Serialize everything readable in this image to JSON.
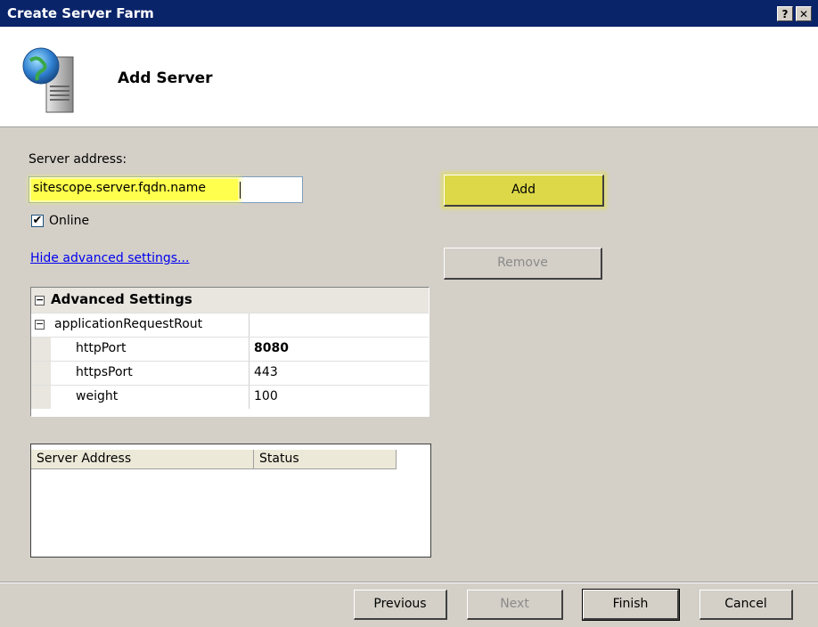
{
  "window": {
    "title": "Create Server Farm",
    "help_label": "?",
    "close_label": "✕"
  },
  "header": {
    "icon": "server-globe-icon",
    "title": "Add Server"
  },
  "form": {
    "server_address_label": "Server address:",
    "server_address_value": "sitescope.server.fqdn.name",
    "online_label": "Online",
    "online_checked": true,
    "advanced_link": "Hide advanced settings..."
  },
  "buttons": {
    "add": "Add",
    "remove": "Remove"
  },
  "advanced": {
    "category": "Advanced Settings",
    "group": "applicationRequestRout",
    "expander_symbol": "⊟",
    "properties": [
      {
        "name": "httpPort",
        "value": "8080"
      },
      {
        "name": "httpsPort",
        "value": "443"
      },
      {
        "name": "weight",
        "value": "100"
      }
    ]
  },
  "server_list": {
    "columns": [
      "Server Address",
      "Status"
    ],
    "rows": []
  },
  "footer": {
    "previous": "Previous",
    "next": "Next",
    "finish": "Finish",
    "cancel": "Cancel"
  },
  "colors": {
    "titlebar": "#0a246a",
    "highlight": "#ffff4d",
    "dialog_bg": "#d4d0c8"
  }
}
